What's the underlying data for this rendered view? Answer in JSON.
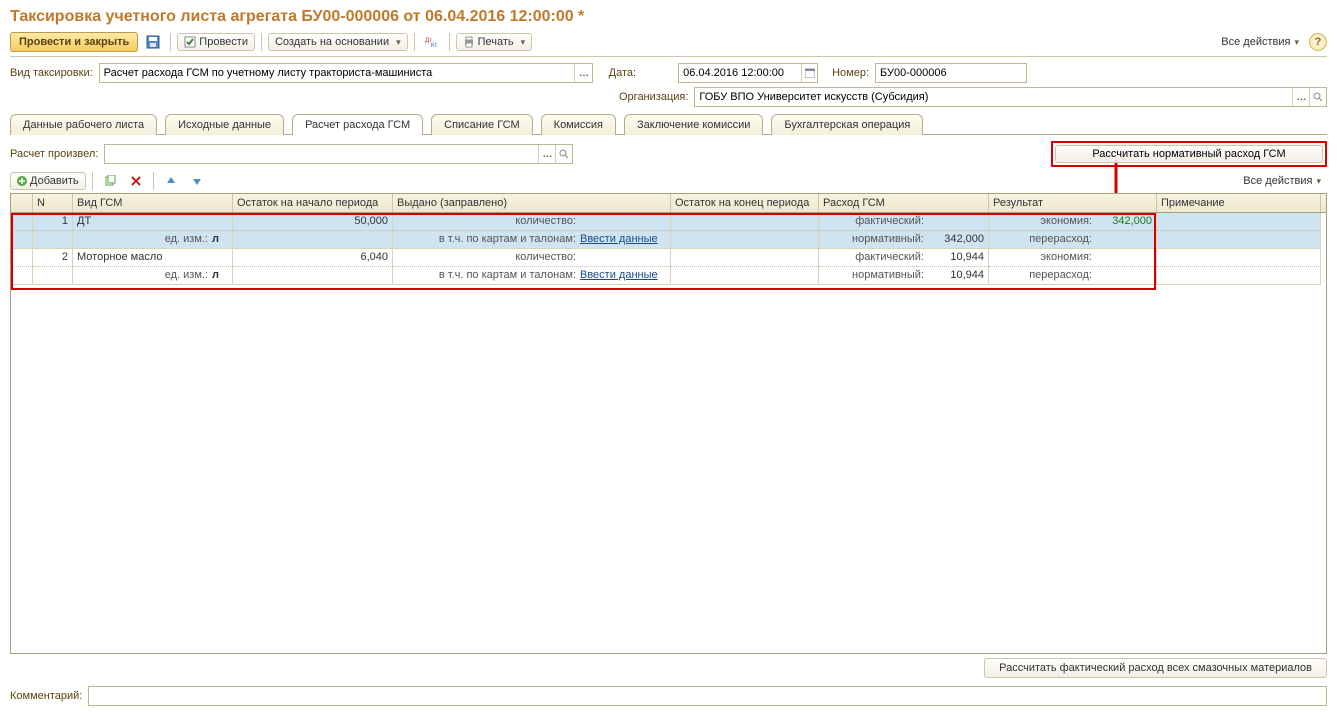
{
  "title": "Таксировка учетного листа агрегата БУ00-000006 от 06.04.2016 12:00:00 *",
  "toolbar": {
    "post_close": "Провести и закрыть",
    "post": "Провести",
    "create_on": "Создать на основании",
    "print": "Печать",
    "all_actions": "Все действия"
  },
  "fields": {
    "type_label": "Вид таксировки:",
    "type_value": "Расчет расхода ГСМ по учетному листу тракториста-машиниста",
    "date_label": "Дата:",
    "date_value": "06.04.2016 12:00:00",
    "number_label": "Номер:",
    "number_value": "БУ00-000006",
    "org_label": "Организация:",
    "org_value": "ГОБУ ВПО Университет искусств (Субсидия)"
  },
  "tabs": [
    "Данные рабочего листа",
    "Исходные данные",
    "Расчет расхода ГСМ",
    "Списание ГСМ",
    "Комиссия",
    "Заключение комиссии",
    "Бухгалтерская операция"
  ],
  "active_tab": 2,
  "calc": {
    "calc_by_label": "Расчет произвел:",
    "calc_btn": "Рассчитать нормативный расход ГСМ"
  },
  "grid_toolbar": {
    "add": "Добавить",
    "all_actions": "Все действия"
  },
  "columns": {
    "n": "N",
    "type": "Вид ГСМ",
    "start": "Остаток на начало периода",
    "issued": "Выдано (заправлено)",
    "end": "Остаток на конец периода",
    "consumption": "Расход ГСМ",
    "result": "Результат",
    "note": "Примечание"
  },
  "sub": {
    "unit": "ед. изм.:",
    "l": "л",
    "qty": "количество:",
    "by_cards": "в т.ч. по картам и талонам:",
    "enter_data": "Ввести данные",
    "actual": "фактический:",
    "normative": "нормативный:",
    "economy": "экономия:",
    "over": "перерасход:"
  },
  "rows": [
    {
      "n": "1",
      "type": "ДТ",
      "start": "50,000",
      "normative": "342,000",
      "economy": "342,000",
      "selected": true
    },
    {
      "n": "2",
      "type": "Моторное масло",
      "start": "6,040",
      "actual": "10,944",
      "normative": "10,944",
      "selected": false
    }
  ],
  "bottom_btn": "Рассчитать фактический расход всех смазочных материалов",
  "comment_label": "Комментарий:"
}
